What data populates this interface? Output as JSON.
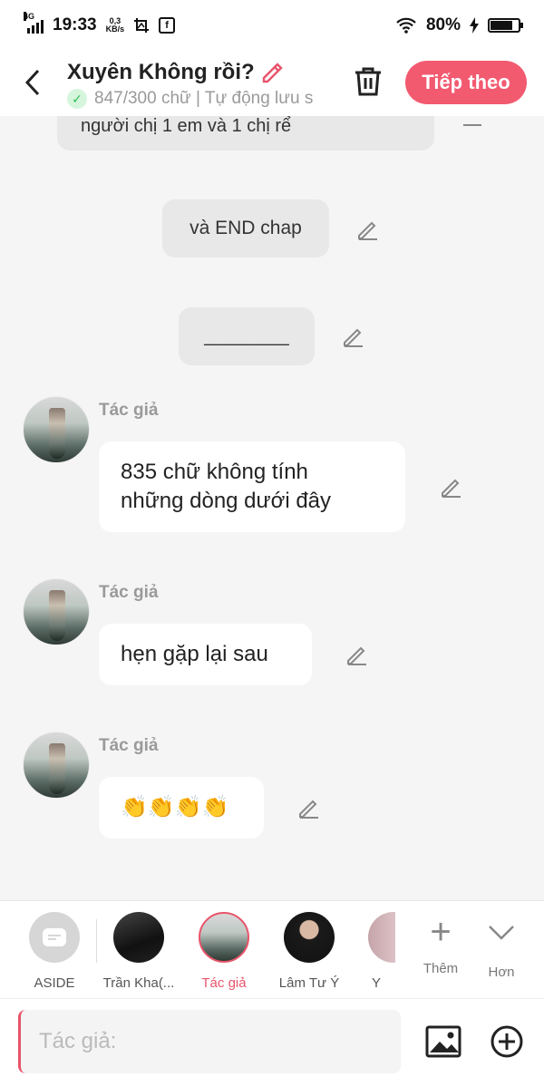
{
  "status_bar": {
    "network": "4G",
    "time": "19:33",
    "speed_value": "0,3",
    "speed_unit": "KB/s",
    "battery": "80%",
    "battery_level": 0.8
  },
  "header": {
    "title": "Xuyên Không rồi?",
    "subtitle": "847/300 chữ | Tự động lưu s",
    "next_label": "Tiếp theo"
  },
  "chat": {
    "partial_text": "người chị 1 em và 1 chị rể",
    "aside_end": "và END chap",
    "aside_line": "________",
    "messages": [
      {
        "speaker": "Tác giả",
        "lines": [
          "835 chữ không tính",
          "những dòng dưới đây"
        ]
      },
      {
        "speaker": "Tác giả",
        "lines": [
          "hẹn gặp lại sau"
        ]
      },
      {
        "speaker": "Tác giả",
        "lines": [
          "👏👏👏👏"
        ]
      }
    ]
  },
  "characters": [
    {
      "name": "ASIDE"
    },
    {
      "name": "Trần Kha(..."
    },
    {
      "name": "Tác giả",
      "active": true
    },
    {
      "name": "Lâm Tư Ý"
    },
    {
      "name": "Y"
    }
  ],
  "more": {
    "add_label": "Thêm",
    "more_label": "Hơn"
  },
  "input": {
    "placeholder": "Tác giả:"
  },
  "colors": {
    "accent": "#f25a70",
    "check_green": "#2fbf58"
  }
}
